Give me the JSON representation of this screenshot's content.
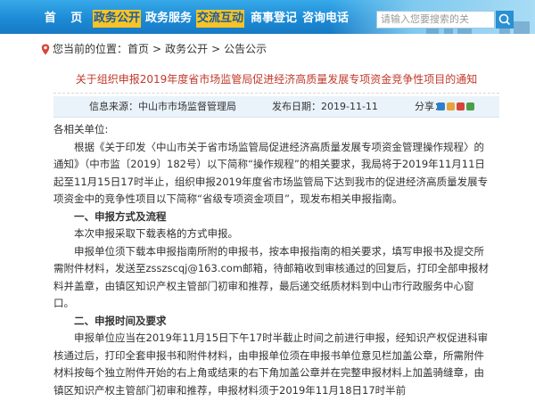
{
  "nav": {
    "items": [
      {
        "label": "首 页"
      },
      {
        "label": "政务公开"
      },
      {
        "label": "政务服务"
      },
      {
        "label": "交流互动"
      },
      {
        "label": "商事登记"
      },
      {
        "label": "咨询电话"
      }
    ],
    "active_index": 1,
    "search_placeholder": "请输入您要搜索的关"
  },
  "breadcrumb": {
    "prefix": "您当前的位置：",
    "items": [
      "首页",
      "政务公开",
      "公告公示"
    ],
    "separator": ">"
  },
  "article": {
    "title": "关于组织申报2019年度省市场监管局促进经济高质量发展专项资金竞争性项目的通知",
    "source_label": "信息来源：",
    "source": "中山市市场监督管理局",
    "date_label": "发布日期：",
    "date": "2019-11-11",
    "share_label": "分享：",
    "greeting": "各相关单位:",
    "para1": "根据《关于印发〈中山市关于省市场监管局促进经济高质量发展专项资金管理操作规程〉的通知》（中市监〔2019〕182号）以下简称“操作规程”的相关要求，我局将于2019年11月11日起至11月15日17时半止，组织申报2019年度省市场监管局下达到我市的促进经济高质量发展专项资金中的竞争性项目以下简称“省级专项资金项目”，现发布相关申报指南。",
    "heading1": "一、申报方式及流程",
    "para2": "本次申报采取下载表格的方式申报。",
    "para3": "申报单位须下载本申报指南所附的申报书，按本申报指南的相关要求，填写申报书及提交所需附件材料，发送至zsszscqj@163.com邮箱，待邮箱收到审核通过的回复后，打印全部申报材料并盖章，由镇区知识产权主管部门初审和推荐，最后递交纸质材料到中山市行政服务中心窗口。",
    "heading2": "二、申报时间及要求",
    "para4": "申报单位应当在2019年11月15日下午17时半截止时间之前进行申报，经知识产权促进科审核通过后，打印全套申报书和附件材料，由申报单位须在申报书单位意见栏加盖公章，所需附件材料按每个独立附件开始的右上角或结束的右下角加盖公章并在完整申报材料上加盖骑缝章，由镇区知识产权主管部门初审和推荐，申报材料须于2019年11月18日17时半前"
  },
  "colors": {
    "nav_bg": "#1d8bd6",
    "nav_active_bg": "#f7c326",
    "title_red": "#c0392b",
    "meta_bg": "#eaf3fa",
    "share_icons": [
      "#2f80c9",
      "#e8a23a",
      "#d9443a",
      "#4aa04a"
    ]
  },
  "icons": {
    "breadcrumb": "location-pin-icon",
    "search": "search-icon"
  }
}
